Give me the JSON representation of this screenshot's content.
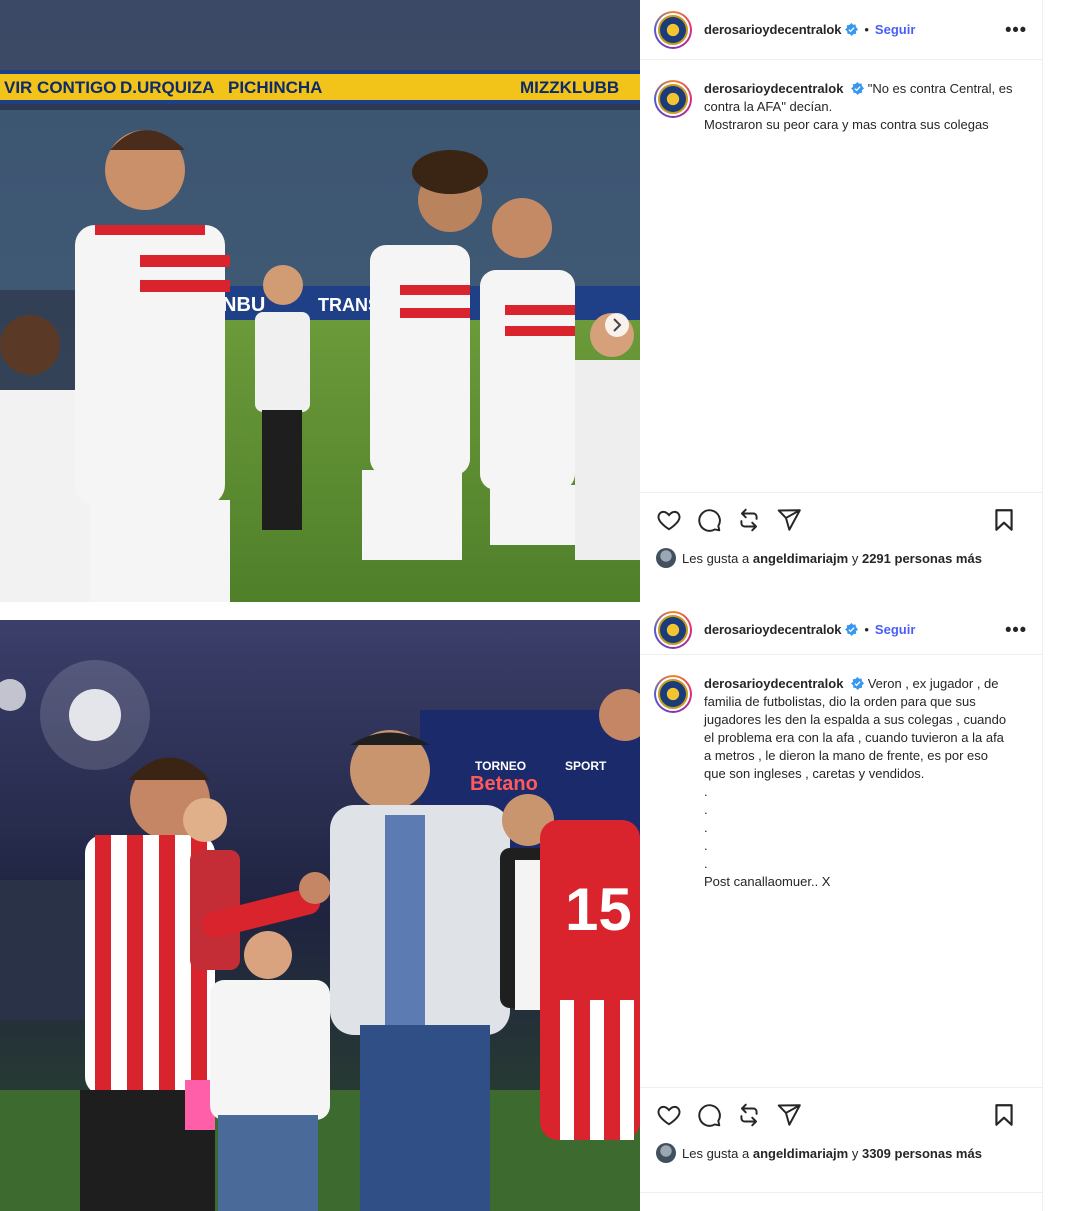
{
  "posts": [
    {
      "username": "derosarioydecentralok",
      "follow_label": "Seguir",
      "separator": "•",
      "more_label": "•••",
      "caption_lines": [
        "\"No es contra Central, es",
        "contra la AFA\" decían.",
        "Mostraron su peor cara y mas contra sus colegas"
      ],
      "likes": {
        "prefix": "Les gusta a",
        "user": "angeldimariajm",
        "joiner": "y",
        "count_text": "2291 personas más"
      },
      "photo_banners": [
        "VIR CONTIGO",
        "D.URQUIZA",
        "PICHINCHA",
        "MIZZKLUBB",
        "NBU",
        "TRANS"
      ]
    },
    {
      "username": "derosarioydecentralok",
      "follow_label": "Seguir",
      "separator": "•",
      "more_label": "•••",
      "caption_lines": [
        "Veron , ex jugador , de",
        "familia de futbolistas, dio la orden para que sus",
        "jugadores les den la espalda a sus colegas , cuando",
        "el problema era con la afa , cuando tuvieron a la afa",
        "a metros , le dieron la mano de frente, es por eso",
        "que son ingleses , caretas y vendidos.",
        ".",
        ".",
        ".",
        ".",
        ".",
        "Post canallaomuer.. X"
      ],
      "likes": {
        "prefix": "Les gusta a",
        "user": "angeldimariajm",
        "joiner": "y",
        "count_text": "3309 personas más"
      },
      "photo_banners": [
        "TORNEO",
        "Betano",
        "SPORT",
        "15"
      ]
    }
  ],
  "colors": {
    "follow": "#4a5df9",
    "verified": "#3897f0",
    "text": "#262626",
    "border": "#efefef"
  },
  "icons": [
    "heart-icon",
    "comment-icon",
    "repost-icon",
    "share-icon",
    "bookmark-icon",
    "verified-icon",
    "more-icon"
  ]
}
